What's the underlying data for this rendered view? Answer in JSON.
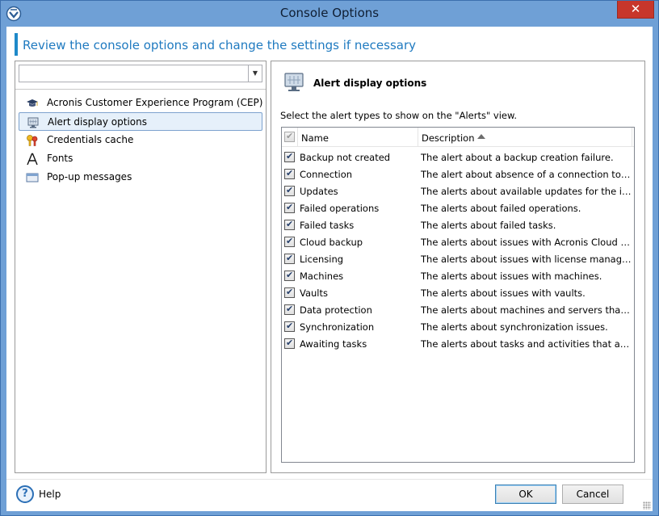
{
  "window": {
    "title": "Console Options",
    "close_glyph": "✕",
    "app_icon": "acronis-icon"
  },
  "header": {
    "text": "Review the console options and change the settings if necessary"
  },
  "left_panel": {
    "combo_value": "",
    "tree": [
      {
        "label": "Acronis Customer Experience Program (CEP)",
        "icon": "graduation-cap-icon",
        "selected": false
      },
      {
        "label": "Alert display options",
        "icon": "monitor-icon",
        "selected": true
      },
      {
        "label": "Credentials cache",
        "icon": "keys-icon",
        "selected": false
      },
      {
        "label": "Fonts",
        "icon": "font-icon",
        "selected": false
      },
      {
        "label": "Pop-up messages",
        "icon": "window-icon",
        "selected": false
      }
    ]
  },
  "right_panel": {
    "title": "Alert display options",
    "instruction": "Select the alert types to show on the \"Alerts\" view.",
    "columns": {
      "name": "Name",
      "description": "Description"
    },
    "rows": [
      {
        "name": "Backup not created",
        "description": "The alert about a backup creation failure.",
        "checked": true
      },
      {
        "name": "Connection",
        "description": "The alert about absence of a connection to t...",
        "checked": true
      },
      {
        "name": "Updates",
        "description": "The alerts about available updates for the in...",
        "checked": true
      },
      {
        "name": "Failed operations",
        "description": "The alerts about failed operations.",
        "checked": true
      },
      {
        "name": "Failed tasks",
        "description": "The alerts about failed tasks.",
        "checked": true
      },
      {
        "name": "Cloud backup",
        "description": "The alerts about issues with Acronis Cloud S...",
        "checked": true
      },
      {
        "name": "Licensing",
        "description": "The alerts about issues with license manage...",
        "checked": true
      },
      {
        "name": "Machines",
        "description": "The alerts about issues with machines.",
        "checked": true
      },
      {
        "name": "Vaults",
        "description": "The alerts about issues with vaults.",
        "checked": true
      },
      {
        "name": "Data protection",
        "description": "The alerts about machines and servers that ...",
        "checked": true
      },
      {
        "name": "Synchronization",
        "description": "The alerts about synchronization issues.",
        "checked": true
      },
      {
        "name": "Awaiting tasks",
        "description": "The alerts about tasks and activities that are ...",
        "checked": true
      }
    ]
  },
  "footer": {
    "help_label": "Help",
    "help_glyph": "?",
    "ok_label": "OK",
    "cancel_label": "Cancel"
  },
  "colors": {
    "titlebar": "#6fa0d6",
    "header_accent": "#1e89c9",
    "close_button": "#c7362b",
    "selection": "#e6f0fa"
  }
}
